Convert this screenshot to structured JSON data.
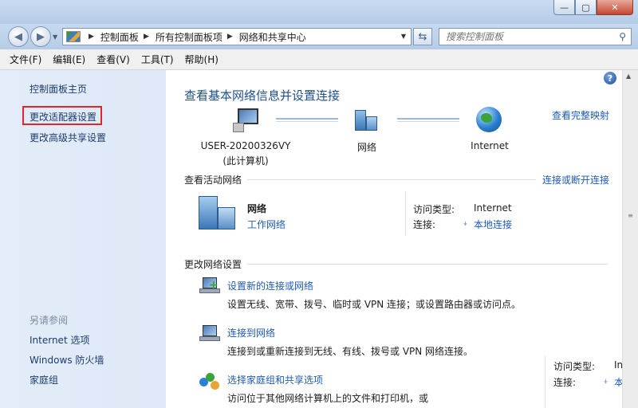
{
  "window": {
    "controls": {
      "minimize": "—",
      "maximize": "▢",
      "close": "✕"
    }
  },
  "address_bar": {
    "breadcrumbs": [
      "控制面板",
      "所有控制面板项",
      "网络和共享中心"
    ],
    "search_placeholder": "搜索控制面板"
  },
  "menu": [
    "文件(F)",
    "编辑(E)",
    "查看(V)",
    "工具(T)",
    "帮助(H)"
  ],
  "sidebar": {
    "links": [
      "控制面板主页",
      "更改适配器设置",
      "更改高级共享设置"
    ],
    "highlighted": "更改适配器设置",
    "see_also_title": "另请参阅",
    "see_also": [
      "Internet 选项",
      "Windows 防火墙",
      "家庭组"
    ]
  },
  "main": {
    "title": "查看基本网络信息并设置连接",
    "full_map_link": "查看完整映射",
    "map": {
      "computer_name": "USER-20200326VY",
      "computer_sub": "(此计算机)",
      "network": "网络",
      "internet": "Internet"
    },
    "active_networks": {
      "title": "查看活动网络",
      "connect_link": "连接或断开连接",
      "network_name": "网络",
      "network_type": "工作网络",
      "access_type_label": "访问类型:",
      "access_type_value": "Internet",
      "connection_label": "连接:",
      "connection_value": "本地连接"
    },
    "change_settings": {
      "title": "更改网络设置",
      "tasks": [
        {
          "title": "设置新的连接或网络",
          "desc": "设置无线、宽带、拨号、临时或 VPN 连接；或设置路由器或访问点。"
        },
        {
          "title": "连接到网络",
          "desc": "连接到或重新连接到无线、有线、拨号或 VPN 网络连接。"
        },
        {
          "title": "选择家庭组和共享选项",
          "desc": "访问位于其他网络计算机上的文件和打印机，或"
        }
      ]
    },
    "tooltip": {
      "access_type_label": "访问类型:",
      "access_type_value": "Intern",
      "connection_label": "连接:",
      "connection_value": "本地"
    }
  },
  "colors": {
    "link": "#1e5bb8",
    "heading": "#1f4f8e",
    "highlight_border": "#e0282c",
    "sidebar_bg": "#e3ecf8"
  }
}
